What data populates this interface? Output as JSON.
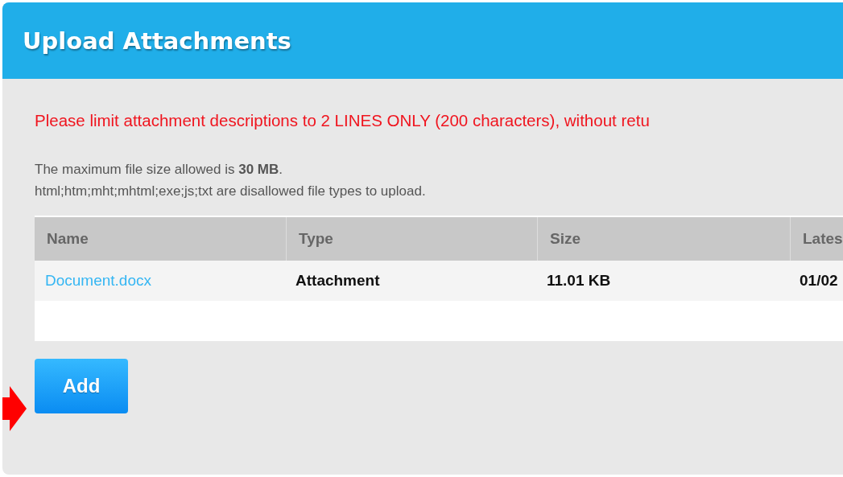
{
  "dialog": {
    "title": "Upload Attachments"
  },
  "warning": "Please limit attachment descriptions to 2 LINES ONLY (200 characters), without retu",
  "info_lines": [
    "The maximum file size allowed is **30 MB**.",
    "html;htm;mht;mhtml;exe;js;txt are disallowed file types to upload."
  ],
  "table": {
    "columns": [
      "Name",
      "Type",
      "Size",
      "Lates"
    ],
    "rows": [
      {
        "name": "Document.docx",
        "type": "Attachment",
        "size": "11.01 KB",
        "column_4": "01/02"
      }
    ]
  },
  "buttons": [
    "Add"
  ]
}
